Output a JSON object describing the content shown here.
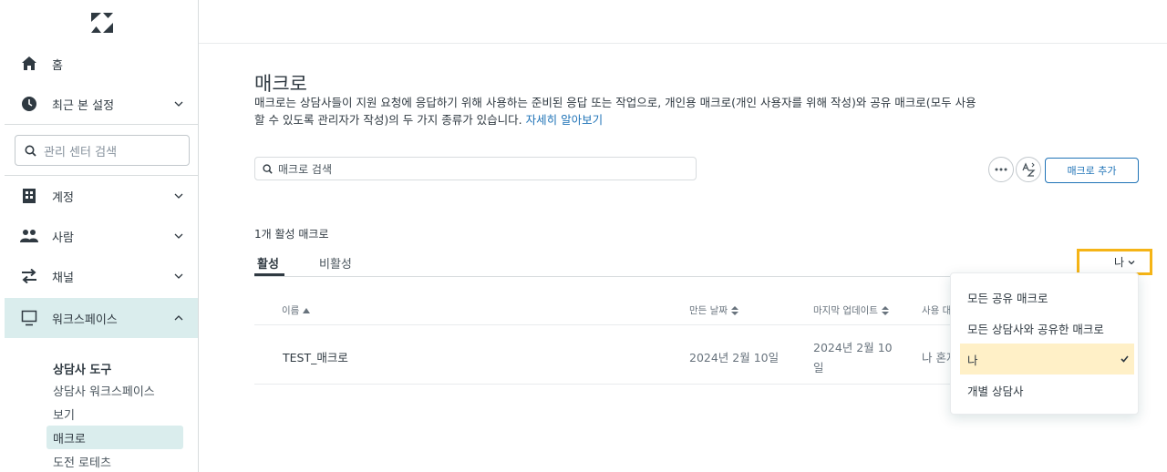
{
  "sidebar": {
    "home": "홈",
    "recent_settings": "최근 본 설정",
    "search_placeholder": "관리 센터 검색",
    "account": "계정",
    "people": "사람",
    "channels": "채널",
    "workspaces": "워크스페이스",
    "section_title": "상담사 도구",
    "sub_items": [
      "상담사 워크스페이스",
      "보기",
      "매크로",
      "도전 로테츠"
    ]
  },
  "main": {
    "title": "매크로",
    "description": "매크로는 상담사들이 지원 요청에 응답하기 위해 사용하는 준비된 응답 또는 작업으로, 개인용 매크로(개인 사용자를 위해 작성)와 공유 매크로(모두 사용할 수 있도록 관리자가 작성)의 두 가지 종류가 있습니다.",
    "learn_more": "자세히 알아보기",
    "search_placeholder": "매크로 검색",
    "add_button": "매크로 추가",
    "active_count": "1개 활성 매크로",
    "tabs": [
      "활성",
      "비활성"
    ],
    "owner_filter": "나",
    "columns": [
      "이름",
      "만든 날짜",
      "마지막 업데이트",
      "사용 대"
    ],
    "rows": [
      {
        "name": "TEST_매크로",
        "created": "2024년 2월 10일",
        "updated_l1": "2024년 2월 10",
        "updated_l2": "일",
        "usage": "나 혼자"
      }
    ]
  },
  "dropdown": {
    "items": [
      "모든 공유 매크로",
      "모든 상담사와 공유한 매크로",
      "나",
      "개별 상담사"
    ],
    "selected": "나"
  },
  "colors": {
    "accent": "#1f73b7",
    "selected_bg": "#fff0c7",
    "highlight_border": "#f5b416",
    "nav_active_bg": "#daeded"
  }
}
